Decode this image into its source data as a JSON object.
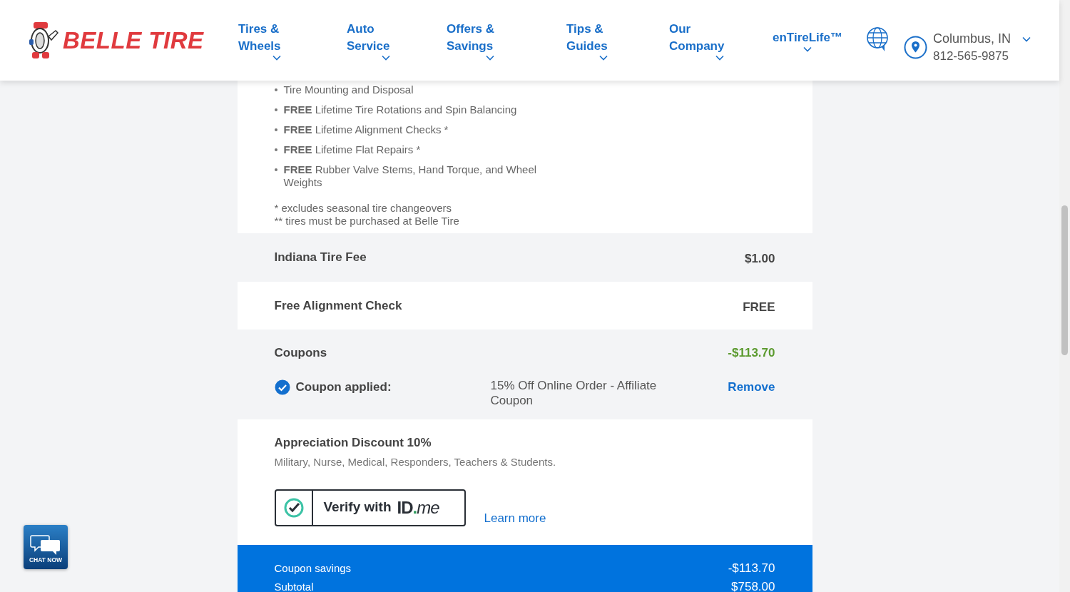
{
  "header": {
    "logo_text": "BELLE TIRE",
    "nav": [
      {
        "label": "Tires &\nWheels"
      },
      {
        "label": "Auto\nService"
      },
      {
        "label": "Offers &\nSavings"
      },
      {
        "label": "Tips &\nGuides"
      },
      {
        "label": "Our\nCompany"
      },
      {
        "label": "enTireLife™"
      }
    ],
    "location": {
      "city": "Columbus, IN",
      "phone": "812-565-9875"
    }
  },
  "benefits": [
    "Tire Mounting and Disposal",
    "**FREE** Lifetime Tire Rotations and Spin Balancing",
    "**FREE** Lifetime Alignment Checks *",
    "**FREE** Lifetime Flat Repairs *",
    "**FREE** Rubber Valve Stems, Hand Torque, and Wheel Weights"
  ],
  "footnotes": [
    "* excludes seasonal tire changeovers",
    "** tires must be purchased at Belle Tire"
  ],
  "fees": [
    {
      "label": "Indiana Tire Fee",
      "amount": "$1.00",
      "shaded": true
    },
    {
      "label": "Free Alignment Check",
      "amount": "FREE",
      "shaded": false
    }
  ],
  "coupons": {
    "label": "Coupons",
    "amount": "-$113.70",
    "applied_label": "Coupon applied:",
    "description": "15% Off Online Order - Affiliate Coupon",
    "action": "Remove"
  },
  "discount": {
    "title": "Appreciation Discount 10%",
    "subtitle": "Military, Nurse, Medical, Responders, Teachers & Students.",
    "verify_label": "Verify with",
    "brand": {
      "strong": "ID",
      "dot": ".",
      "tail": "me"
    },
    "link": "Learn more"
  },
  "summary": [
    {
      "label": "Coupon savings",
      "value": "-$113.70"
    },
    {
      "label": "Subtotal",
      "value": "$758.00"
    }
  ],
  "chat": {
    "label": "CHAT NOW"
  }
}
